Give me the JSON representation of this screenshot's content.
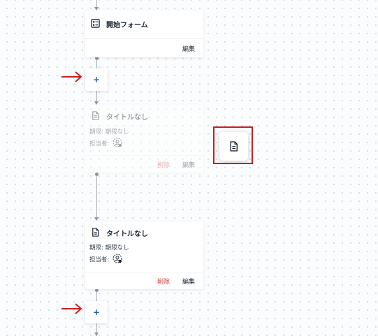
{
  "start_card": {
    "title": "開始フォーム",
    "icon": "form-icon",
    "edit_label": "編集"
  },
  "ghost_card": {
    "title": "タイトルなし",
    "icon": "document-icon",
    "deadline": "期限: 期限なし",
    "assignee_label": "担当者:",
    "delete_label": "削除",
    "edit_label": "編集"
  },
  "task_card": {
    "title": "タイトルなし",
    "icon": "document-icon",
    "deadline": "期限: 期限なし",
    "assignee_label": "担当者:",
    "delete_label": "削除",
    "edit_label": "編集"
  },
  "add_step_buttons": [
    {
      "label": "+"
    },
    {
      "label": "+"
    }
  ],
  "drag_tile": {
    "icon": "document-icon"
  },
  "colors": {
    "accent": "#1f5fb3",
    "delete": "#d63b3b",
    "annotation": "#c42020"
  }
}
